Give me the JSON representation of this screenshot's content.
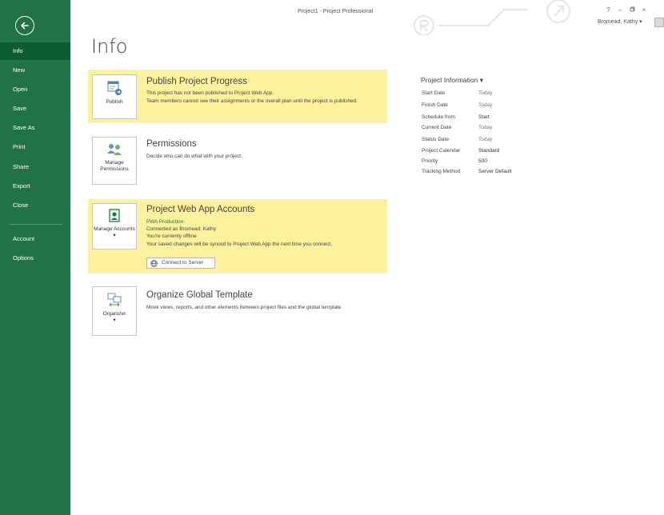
{
  "window": {
    "title": "Project1 - Project Professional",
    "controls": [
      "?",
      "–",
      "̅",
      "×"
    ],
    "user": "Bromead, Kathy",
    "user_caret": "▾"
  },
  "sidebar": {
    "items": [
      {
        "label": "Info",
        "active": true
      },
      {
        "label": "New"
      },
      {
        "label": "Open"
      },
      {
        "label": "Save"
      },
      {
        "label": "Save As"
      },
      {
        "label": "Print"
      },
      {
        "label": "Share"
      },
      {
        "label": "Export"
      },
      {
        "label": "Close"
      },
      {
        "label": "Account"
      },
      {
        "label": "Options"
      }
    ]
  },
  "page_title": "Info",
  "sections": {
    "publish": {
      "tile_label": "Publish",
      "title": "Publish Project Progress",
      "text1": "This project has not been published to Project Web App.",
      "text2": "Team members cannot see their assignments or the overall plan until the project is published."
    },
    "permissions": {
      "tile_label": "Manage Permissions",
      "title": "Permissions",
      "text": "Decide who can do what with your project."
    },
    "pwa": {
      "tile_label": "Manage Accounts ▾",
      "title": "Project Web App Accounts",
      "server": "PWA Production",
      "connected_as": "Connected as Bromead; Kathy",
      "offline": "You're currently offline",
      "sync_note": "Your saved changes will be synced to Project Web App the next time you connect.",
      "connect_button": "Connect to Server"
    },
    "organizer": {
      "tile_label": "Organizer",
      "tile_caret": "▾",
      "title": "Organize Global Template",
      "text": "Move views, reports, and other elements between project files and the global template."
    }
  },
  "project_info": {
    "title": "Project Information",
    "title_caret": "▾",
    "rows": [
      {
        "label": "Start Date",
        "value": "Today"
      },
      {
        "label": "Finish Date",
        "value": "Today"
      },
      {
        "label": "Schedule from",
        "value": "Start"
      },
      {
        "label": "Current Date",
        "value": "Today"
      },
      {
        "label": "Status Date",
        "value": "Today"
      },
      {
        "label": "Project Calendar",
        "value": "Standard"
      },
      {
        "label": "Priority",
        "value": "500"
      },
      {
        "label": "Tracking Method",
        "value": "Server Default"
      }
    ]
  },
  "colors": {
    "sidebar": "#217346",
    "sidebar_active": "#0e5c2f",
    "highlight": "#fcf29e",
    "link": "#217346"
  }
}
